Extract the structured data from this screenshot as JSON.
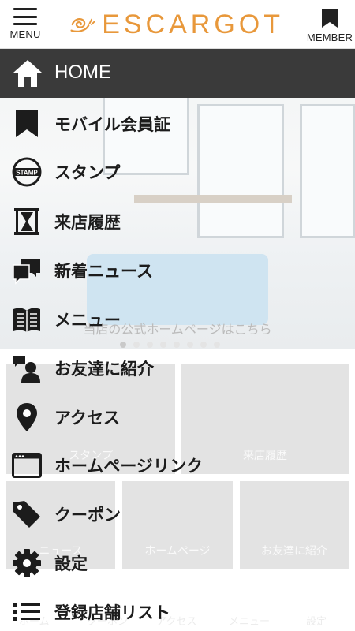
{
  "header": {
    "menu_label": "MENU",
    "member_label": "MEMBER",
    "logo_text": "ESCARGOT",
    "brand_color": "#e8983b"
  },
  "background": {
    "caption": "当店の公式ホームページはこちら",
    "tiles": [
      {
        "label": "スタンプ"
      },
      {
        "label": "来店履歴"
      },
      {
        "label": "ニュース"
      },
      {
        "label": "ホームページ"
      },
      {
        "label": "お友達に紹介"
      }
    ],
    "bottom_nav": [
      "ホーム",
      "クーポン",
      "アクセス",
      "メニュー",
      "設定"
    ]
  },
  "drawer": {
    "home_label": "HOME",
    "items": [
      {
        "label": "モバイル会員証",
        "icon": "bookmark-icon"
      },
      {
        "label": "スタンプ",
        "icon": "stamp-icon"
      },
      {
        "label": "来店履歴",
        "icon": "hourglass-icon"
      },
      {
        "label": "新着ニュース",
        "icon": "chat-bubbles-icon"
      },
      {
        "label": "メニュー",
        "icon": "book-icon"
      },
      {
        "label": "お友達に紹介",
        "icon": "friend-icon"
      },
      {
        "label": "アクセス",
        "icon": "location-pin-icon"
      },
      {
        "label": "ホームページリンク",
        "icon": "browser-window-icon"
      },
      {
        "label": "クーポン",
        "icon": "tag-icon"
      },
      {
        "label": "設定",
        "icon": "gear-icon"
      },
      {
        "label": "登録店舗リスト",
        "icon": "list-icon"
      }
    ]
  }
}
